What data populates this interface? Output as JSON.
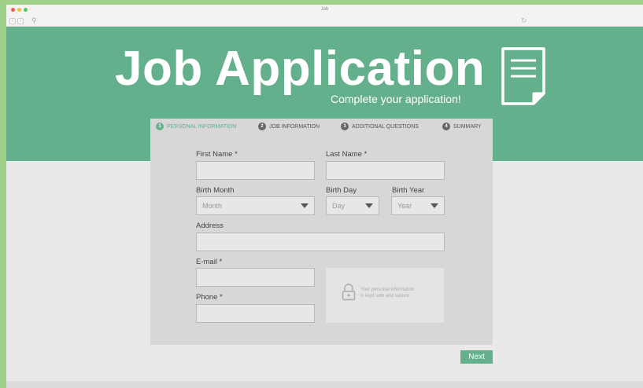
{
  "window": {
    "title": "Job"
  },
  "hero": {
    "title": "Job Application",
    "subtitle": "Complete your application!"
  },
  "steps": [
    {
      "num": "1",
      "label": "PERSONAL INFORMATION"
    },
    {
      "num": "2",
      "label": "JOB INFORMATION"
    },
    {
      "num": "3",
      "label": "ADDITIONAL QUESTIONS"
    },
    {
      "num": "4",
      "label": "SUMMARY"
    }
  ],
  "form": {
    "first_name_label": "First Name *",
    "last_name_label": "Last Name *",
    "birth_month_label": "Birth Month",
    "birth_month_value": "Month",
    "birth_day_label": "Birth Day",
    "birth_day_value": "Day",
    "birth_year_label": "Birth Year",
    "birth_year_value": "Year",
    "address_label": "Address",
    "email_label": "E-mail *",
    "phone_label": "Phone *",
    "secure_line1": "Your personal information",
    "secure_line2": "is kept safe and secure."
  },
  "actions": {
    "next_label": "Next"
  },
  "colors": {
    "accent": "#64b08c",
    "page_bg": "#9fd08a"
  }
}
